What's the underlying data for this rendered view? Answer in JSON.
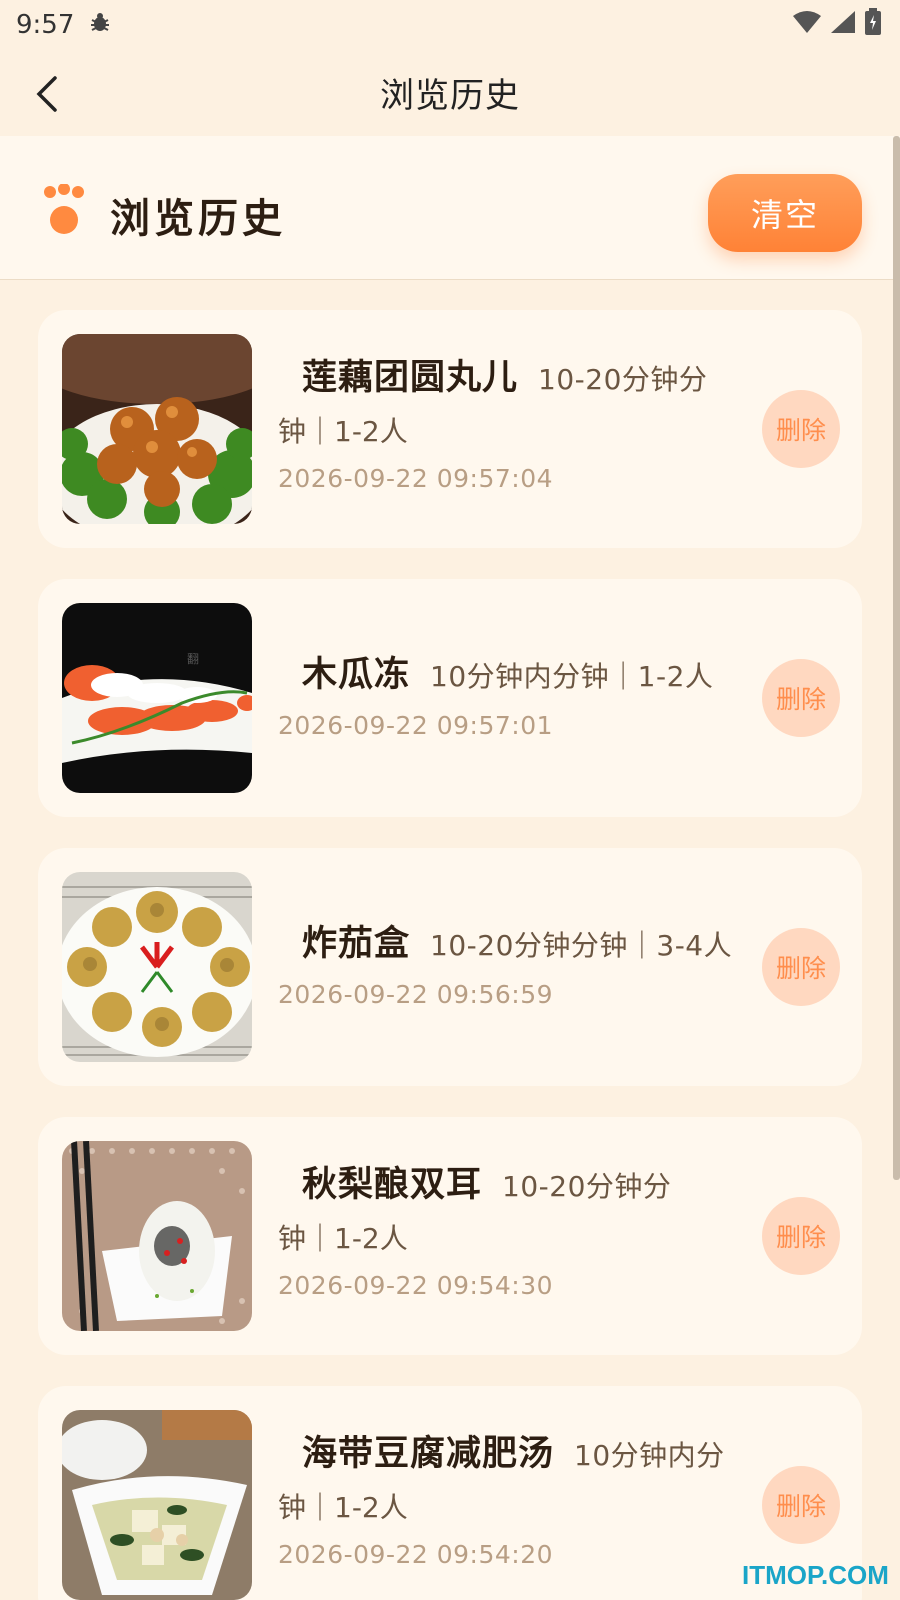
{
  "status_bar": {
    "time": "9:57"
  },
  "app_bar": {
    "title": "浏览历史"
  },
  "header": {
    "title": "浏览历史",
    "clear_label": "清空"
  },
  "items": [
    {
      "name": "莲藕团圆丸儿",
      "meta": "10-20分钟分钟｜1-2人",
      "meta_a": "10-20分钟分",
      "meta_b": "钟｜1-2人",
      "time": "2026-09-22 09:57:04",
      "delete_label": "删除",
      "image": "braised-meatballs-photo"
    },
    {
      "name": "木瓜冻",
      "meta": "10分钟内分钟｜1-2人",
      "time": "2026-09-22 09:57:01",
      "delete_label": "删除",
      "image": "papaya-jelly-photo"
    },
    {
      "name": "炸茄盒",
      "meta": "10-20分钟分钟｜3-4人",
      "time": "2026-09-22 09:56:59",
      "delete_label": "删除",
      "image": "fried-eggplant-box-photo"
    },
    {
      "name": "秋梨酿双耳",
      "meta_a": "10-20分钟分",
      "meta_b": "钟｜1-2人",
      "time": "2026-09-22 09:54:30",
      "delete_label": "删除",
      "image": "stuffed-pear-photo"
    },
    {
      "name": "海带豆腐减肥汤",
      "meta_a": "10分钟内分",
      "meta_b": "钟｜1-2人",
      "time": "2026-09-22 09:54:20",
      "delete_label": "删除",
      "image": "kelp-tofu-soup-photo"
    }
  ],
  "watermark": "ITMOP.COM",
  "colors": {
    "accent": "#FF8A40",
    "background": "#FDF1E1",
    "card": "#FFF8EE",
    "delete_bg": "#FFD8C0"
  }
}
